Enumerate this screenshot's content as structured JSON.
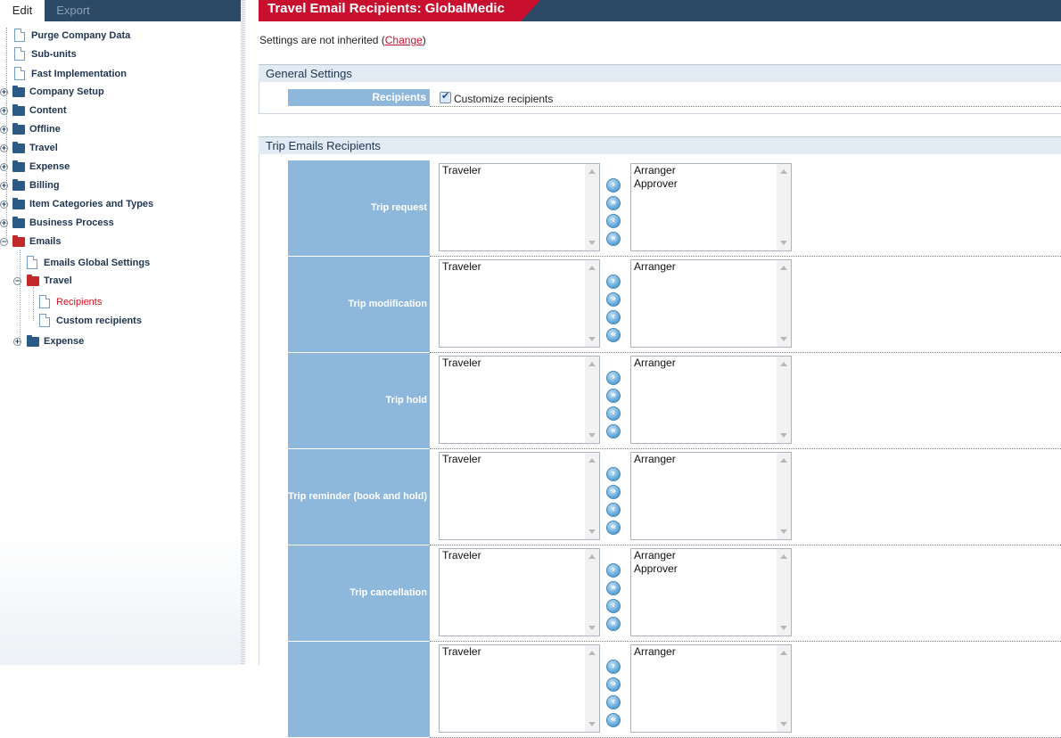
{
  "left_tabs": {
    "edit": "Edit",
    "export": "Export"
  },
  "tree": [
    {
      "label": "Purge Company Data",
      "type": "doc",
      "level": 1
    },
    {
      "label": "Sub-units",
      "type": "doc",
      "level": 1
    },
    {
      "label": "Fast Implementation",
      "type": "doc",
      "level": 1
    },
    {
      "label": "Company Setup",
      "type": "folder",
      "level": 0
    },
    {
      "label": "Content",
      "type": "folder",
      "level": 0
    },
    {
      "label": "Offline",
      "type": "folder",
      "level": 0
    },
    {
      "label": "Travel",
      "type": "folder",
      "level": 0
    },
    {
      "label": "Expense",
      "type": "folder",
      "level": 0
    },
    {
      "label": "Billing",
      "type": "folder",
      "level": 0
    },
    {
      "label": "Item Categories and Types",
      "type": "folder",
      "level": 0
    },
    {
      "label": "Business Process",
      "type": "folder",
      "level": 0
    },
    {
      "label": "Emails",
      "type": "folder-open",
      "level": 0
    },
    {
      "label": "Emails Global Settings",
      "type": "doc",
      "level": 2
    },
    {
      "label": "Travel",
      "type": "folder-open",
      "level": 1
    },
    {
      "label": "Recipients",
      "type": "doc",
      "level": 3,
      "active": true
    },
    {
      "label": "Custom recipients",
      "type": "doc",
      "level": 3
    },
    {
      "label": "Expense",
      "type": "folder",
      "level": 1
    }
  ],
  "page": {
    "title": "Travel Email Recipients: GlobalMedic",
    "inherit_text": "Settings are not inherited (",
    "inherit_link": "Change",
    "inherit_close": ")"
  },
  "general_settings": {
    "heading": "General Settings",
    "recipients_label": "Recipients",
    "customize_label": "Customize recipients",
    "customize_checked": true
  },
  "trip_emails": {
    "heading": "Trip Emails Recipients",
    "rows": [
      {
        "label": "Trip request",
        "available": [
          "Traveler"
        ],
        "selected": [
          "Arranger",
          "Approver"
        ]
      },
      {
        "label": "Trip modification",
        "available": [
          "Traveler"
        ],
        "selected": [
          "Arranger"
        ]
      },
      {
        "label": "Trip hold",
        "available": [
          "Traveler"
        ],
        "selected": [
          "Arranger"
        ]
      },
      {
        "label": "Trip reminder (book and hold)",
        "available": [
          "Traveler"
        ],
        "selected": [
          "Arranger"
        ]
      },
      {
        "label": "Trip cancellation",
        "available": [
          "Traveler"
        ],
        "selected": [
          "Arranger",
          "Approver"
        ]
      },
      {
        "label": "",
        "available": [
          "Traveler"
        ],
        "selected": [
          "Arranger"
        ]
      }
    ]
  },
  "move_buttons": [
    {
      "name": "move-right-button",
      "glyph": "›"
    },
    {
      "name": "move-all-right-button",
      "glyph": "»"
    },
    {
      "name": "move-left-button",
      "glyph": "‹"
    },
    {
      "name": "move-all-left-button",
      "glyph": "«"
    }
  ],
  "colors": {
    "header_navy": "#2c4a66",
    "title_red": "#c8102e",
    "label_blue": "#8eb7dc"
  }
}
